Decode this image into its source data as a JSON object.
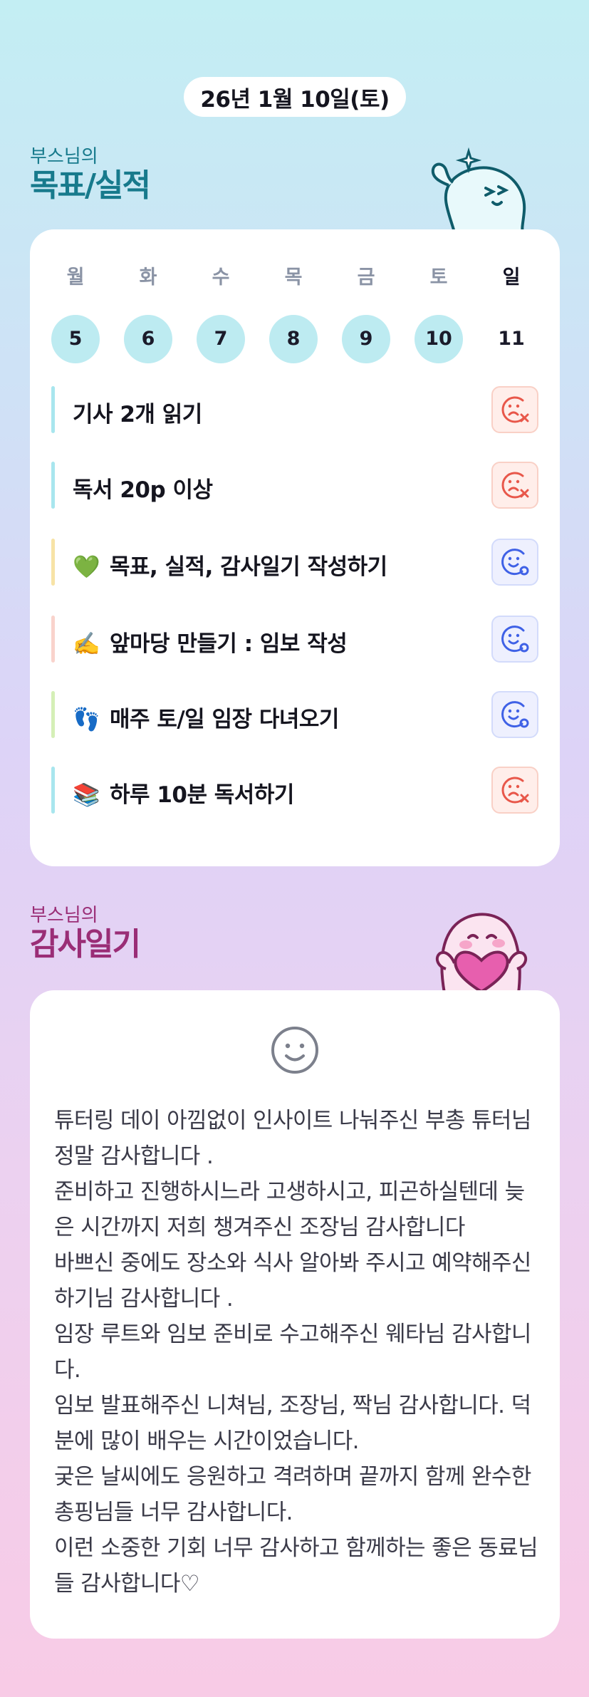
{
  "header": {
    "date": "26년 1월 10일(토)"
  },
  "goals_section": {
    "sub_title": "부스님의",
    "title": "목표/실적"
  },
  "week": [
    {
      "name": "월",
      "num": "5",
      "done": true
    },
    {
      "name": "화",
      "num": "6",
      "done": true
    },
    {
      "name": "수",
      "num": "7",
      "done": true
    },
    {
      "name": "목",
      "num": "8",
      "done": true
    },
    {
      "name": "금",
      "num": "9",
      "done": true
    },
    {
      "name": "토",
      "num": "10",
      "done": true
    },
    {
      "name": "일",
      "num": "11",
      "done": false
    }
  ],
  "goals": [
    {
      "emoji": "",
      "text": "기사 2개 읽기",
      "status": "fail",
      "accent": "#a8e6ee"
    },
    {
      "emoji": "",
      "text": "독서 20p 이상",
      "status": "fail",
      "accent": "#a8e6ee"
    },
    {
      "emoji": "💚",
      "text": "목표, 실적, 감사일기 작성하기",
      "status": "success",
      "accent": "#f7e3a6"
    },
    {
      "emoji": "✍️",
      "text": "앞마당 만들기 : 임보 작성",
      "status": "success",
      "accent": "#f9d3cc"
    },
    {
      "emoji": "👣",
      "text": "매주 토/일 임장 다녀오기",
      "status": "success",
      "accent": "#d5efb7"
    },
    {
      "emoji": "📚",
      "text": "하루 10분 독서하기",
      "status": "fail",
      "accent": "#a8e6ee"
    }
  ],
  "status_colors": {
    "fail": "#e8574a",
    "success": "#3f61e6"
  },
  "icons": {
    "fail": "sad-face-x-icon",
    "success": "smile-face-check-icon",
    "thanks": "smile-face-icon"
  },
  "thanks_section": {
    "sub_title": "부스님의",
    "title": "감사일기",
    "text": "튜터링 데이 아낌없이 인사이트 나눠주신 부총 튜터님 정말 감사합니다 .\n준비하고 진행하시느라 고생하시고, 피곤하실텐데 늦은 시간까지 저희 챙겨주신 조장님 감사합니다\n바쁘신 중에도 장소와 식사 알아봐 주시고 예약해주신 하기님 감사합니다 .\n임장 루트와 임보 준비로 수고해주신 웨타님 감사합니다.\n임보 발표해주신 니쳐님, 조장님, 짝님 감사합니다. 덕분에 많이 배우는 시간이었습니다.\n궂은 날씨에도 응원하고 격려하며 끝까지 함께 완수한 총핑님들 너무 감사합니다.\n이런 소중한 기회 너무 감사하고 함께하는 좋은 동료님들 감사합니다♡"
  },
  "colors": {
    "goal_title": "#177a8c",
    "thanks_title": "#9a2d76",
    "day_circle": "#bdebf1"
  }
}
